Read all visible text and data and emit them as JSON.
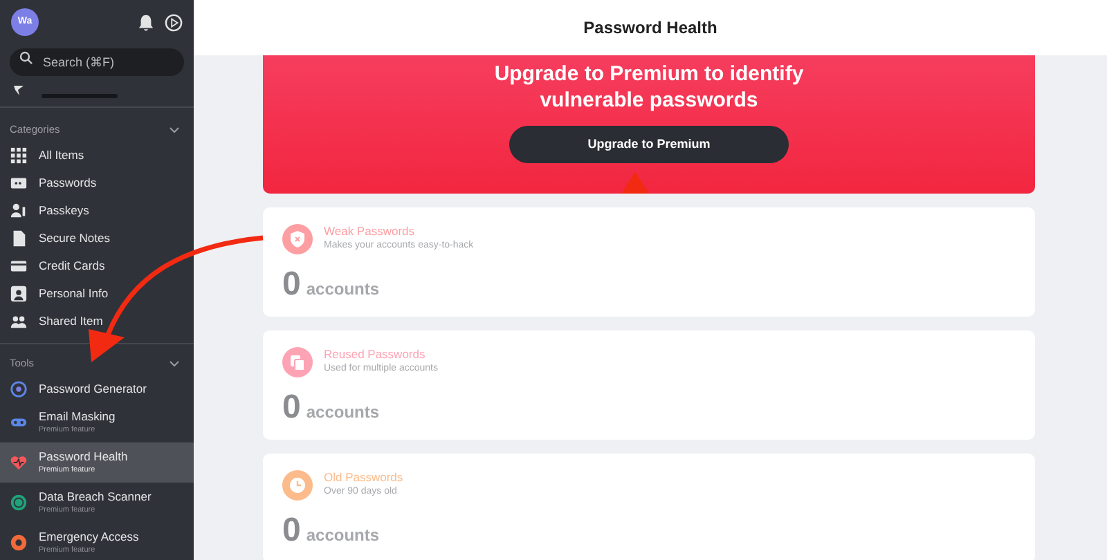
{
  "sidebar": {
    "avatar": "Wa",
    "search": {
      "placeholder": "Search (⌘F)"
    },
    "categories": {
      "title": "Categories",
      "expanded": true,
      "items": [
        {
          "label": "All Items",
          "kind": "grid"
        },
        {
          "label": "Passwords",
          "kind": "password"
        },
        {
          "label": "Passkeys",
          "kind": "passkey"
        },
        {
          "label": "Secure Notes",
          "kind": "note"
        },
        {
          "label": "Credit Cards",
          "kind": "card"
        },
        {
          "label": "Personal Info",
          "kind": "person"
        },
        {
          "label": "Shared Item",
          "kind": "shared"
        }
      ]
    },
    "tools": {
      "title": "Tools",
      "expanded": true,
      "items": [
        {
          "label": "Password Generator",
          "kind": "generator",
          "selected": false
        },
        {
          "label": "Email Masking",
          "sub": "Premium feature",
          "kind": "mask",
          "selected": false
        },
        {
          "label": "Password Health",
          "sub": "Premium feature",
          "kind": "health",
          "selected": true
        },
        {
          "label": "Data Breach Scanner",
          "sub": "Premium feature",
          "kind": "scanner",
          "selected": false
        },
        {
          "label": "Emergency Access",
          "sub": "Premium feature",
          "kind": "lifebuoy",
          "selected": false
        }
      ]
    }
  },
  "header": {
    "title": "Password Health"
  },
  "banner": {
    "heading": "Upgrade to Premium to identify vulnerable passwords",
    "button": "Upgrade to Premium"
  },
  "cards": [
    {
      "title": "Weak Passwords",
      "subtitle": "Makes your accounts easy-to-hack",
      "count": "0",
      "unit": "accounts",
      "color": "#fd9ea2",
      "kind": "shield"
    },
    {
      "title": "Reused Passwords",
      "subtitle": "Used for multiple accounts",
      "count": "0",
      "unit": "accounts",
      "color": "#fda3b4",
      "kind": "copy"
    },
    {
      "title": "Old Passwords",
      "subtitle": "Over 90 days old",
      "count": "0",
      "unit": "accounts",
      "color": "#fcbb8a",
      "kind": "clock"
    }
  ]
}
